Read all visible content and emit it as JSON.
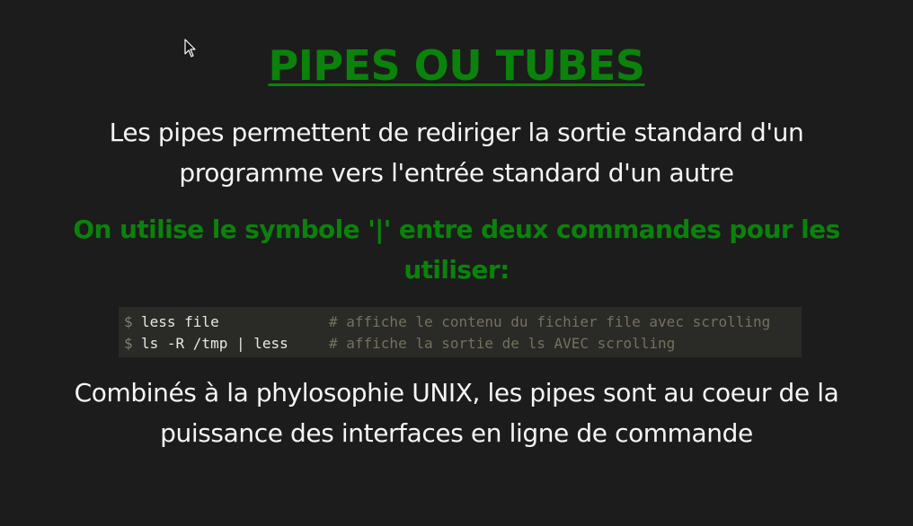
{
  "slide": {
    "title": "PIPES OU TUBES",
    "intro": "Les pipes permettent de rediriger la sortie standard d'un programme vers l'entrée standard d'un autre",
    "emphasis": "On utilise le symbole '|' entre deux commandes pour les utiliser:",
    "outro": "Combinés à la phylosophie UNIX, les pipes sont au coeur de la puissance des interfaces en ligne de commande"
  },
  "code": {
    "lines": [
      {
        "prompt": "$",
        "command": "less file",
        "comment": "# affiche le contenu du fichier file avec scrolling"
      },
      {
        "prompt": "$",
        "command": "ls -R /tmp | less",
        "comment": "# affiche la sortie de ls AVEC scrolling"
      }
    ]
  },
  "colors": {
    "background": "#1c1c1c",
    "accent_green": "#0b820b",
    "code_background": "#2a2a26",
    "comment": "#75715e"
  },
  "icons": {
    "cursor": "mouse-pointer-icon"
  }
}
